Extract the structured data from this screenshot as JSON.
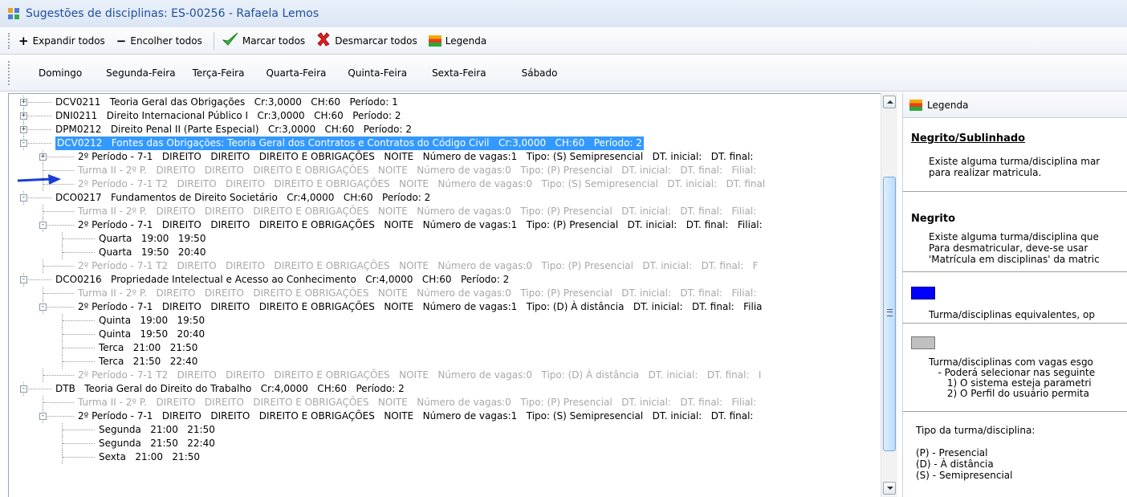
{
  "window": {
    "title": "Sugestões de disciplinas: ES-00256 - Rafaela Lemos"
  },
  "toolbar": {
    "expand_all": "Expandir todos",
    "collapse_all": "Encolher todos",
    "check_all": "Marcar todos",
    "uncheck_all": "Desmarcar todos",
    "legend": "Legenda"
  },
  "days": [
    "Domingo",
    "Segunda-Feira",
    "Terça-Feira",
    "Quarta-Feira",
    "Quinta-Feira",
    "Sexta-Feira",
    "Sábado"
  ],
  "tree": [
    {
      "level": 0,
      "expander": "+",
      "style": "normal",
      "text": "DCV0211   Teoria Geral das Obrigações   Cr:3,0000   CH:60   Período: 1"
    },
    {
      "level": 0,
      "expander": "+",
      "style": "normal",
      "text": "DNI0211   Direito Internacional Público I   Cr:3,0000   CH:60   Período: 2"
    },
    {
      "level": 0,
      "expander": "+",
      "style": "normal",
      "text": "DPM0212   Direito Penal II (Parte Especial)   Cr:3,0000   CH:60   Período: 2"
    },
    {
      "level": 0,
      "expander": "-",
      "style": "selected",
      "text": "DCV0212   Fontes das Obrigações: Teoria Geral dos Contratos e Contratos do Código Civil   Cr:3,0000   CH:60   Período: 2"
    },
    {
      "level": 1,
      "expander": "+",
      "style": "normal",
      "text": "2º Período - 7-1   DIREITO   DIREITO   DIREITO E OBRIGAÇÕES   NOITE   Número de vagas:1   Tipo: (S) Semipresencial   DT. inicial:   DT. final:"
    },
    {
      "level": 1,
      "expander": "",
      "style": "gray",
      "text": "Turma II - 2º P.   DIREITO   DIREITO   DIREITO E OBRIGAÇÕES   NOITE   Número de vagas:0   Tipo: (P) Presencial   DT. inicial:   DT. final:   Filial:"
    },
    {
      "level": 1,
      "expander": "",
      "style": "gray",
      "text": "2º Período - 7-1 T2   DIREITO   DIREITO   DIREITO E OBRIGAÇÕES   NOITE   Número de vagas:0   Tipo: (S) Semipresencial   DT. inicial:   DT. final"
    },
    {
      "level": 0,
      "expander": "-",
      "style": "normal",
      "text": "DCO0217   Fundamentos de Direito Societário   Cr:4,0000   CH:60   Período: 2"
    },
    {
      "level": 1,
      "expander": "",
      "style": "gray",
      "text": "Turma II - 2º P.   DIREITO   DIREITO   DIREITO E OBRIGAÇÕES   NOITE   Número de vagas:0   Tipo: (P) Presencial   DT. inicial:   DT. final:   Filial:"
    },
    {
      "level": 1,
      "expander": "-",
      "style": "normal",
      "text": "2º Período - 7-1   DIREITO   DIREITO   DIREITO E OBRIGAÇÕES   NOITE   Número de vagas:1   Tipo: (P) Presencial   DT. inicial:   DT. final:   Filial:"
    },
    {
      "level": 2,
      "expander": "",
      "style": "normal",
      "text": "Quarta   19:00   19:50"
    },
    {
      "level": 2,
      "expander": "",
      "style": "normal",
      "text": "Quarta   19:50   20:40"
    },
    {
      "level": 1,
      "expander": "",
      "style": "gray",
      "text": "2º Período - 7-1 T2   DIREITO   DIREITO   DIREITO E OBRIGAÇÕES   NOITE   Número de vagas:0   Tipo: (P) Presencial   DT. inicial:   DT. final:   F"
    },
    {
      "level": 0,
      "expander": "-",
      "style": "normal",
      "text": "DCO0216   Propriedade Intelectual e Acesso ao Conhecimento   Cr:4,0000   CH:60   Período: 2"
    },
    {
      "level": 1,
      "expander": "",
      "style": "gray",
      "text": "Turma II - 2º P.   DIREITO   DIREITO   DIREITO E OBRIGAÇÕES   NOITE   Número de vagas:0   Tipo: (P) Presencial   DT. inicial:   DT. final:   Filial:"
    },
    {
      "level": 1,
      "expander": "-",
      "style": "normal",
      "text": "2º Período - 7-1   DIREITO   DIREITO   DIREITO E OBRIGAÇÕES   NOITE   Número de vagas:1   Tipo: (D) À distância   DT. inicial:   DT. final:   Filia"
    },
    {
      "level": 2,
      "expander": "",
      "style": "normal",
      "text": "Quinta   19:00   19:50"
    },
    {
      "level": 2,
      "expander": "",
      "style": "normal",
      "text": "Quinta   19:50   20:40"
    },
    {
      "level": 2,
      "expander": "",
      "style": "normal",
      "text": "Terca   21:00   21:50"
    },
    {
      "level": 2,
      "expander": "",
      "style": "normal",
      "text": "Terca   21:50   22:40"
    },
    {
      "level": 1,
      "expander": "",
      "style": "gray",
      "text": "2º Período - 7-1 T2   DIREITO   DIREITO   DIREITO E OBRIGAÇÕES   NOITE   Número de vagas:0   Tipo: (D) À distância   DT. inicial:   DT. final:   I"
    },
    {
      "level": 0,
      "expander": "-",
      "style": "normal",
      "text": "DTB   Teoria Geral do Direito do Trabalho   Cr:4,0000   CH:60   Período: 2"
    },
    {
      "level": 1,
      "expander": "",
      "style": "gray",
      "text": "Turma II - 2º P.   DIREITO   DIREITO   DIREITO E OBRIGAÇÕES   NOITE   Número de vagas:0   Tipo: (P) Presencial   DT. inicial:   DT. final:   Filial:"
    },
    {
      "level": 1,
      "expander": "-",
      "style": "normal",
      "text": "2º Período - 7-1   DIREITO   DIREITO   DIREITO E OBRIGAÇÕES   NOITE   Número de vagas:1   Tipo: (S) Semipresencial   DT. inicial:   DT. final:"
    },
    {
      "level": 2,
      "expander": "",
      "style": "normal",
      "text": "Segunda   21:00   21:50"
    },
    {
      "level": 2,
      "expander": "",
      "style": "normal",
      "text": "Segunda   21:50   22:40"
    },
    {
      "level": 2,
      "expander": "",
      "style": "normal",
      "text": "Sexta   21:00   21:50"
    }
  ],
  "legend": {
    "header": "Legenda",
    "sections": [
      {
        "title": "Negrito/Sublinhado",
        "underline": true,
        "swatch": "",
        "body": "Existe alguma turma/disciplina mar\npara realizar matricula."
      },
      {
        "title": "Negrito",
        "underline": false,
        "swatch": "",
        "body": "Existe alguma turma/disciplina que\nPara desmatricular, deve-se usar\n'Matrícula em disciplinas' da matric"
      },
      {
        "title": "",
        "underline": false,
        "swatch": "#0000ff",
        "body": "Turma/disciplinas equivalentes, op"
      },
      {
        "title": "",
        "underline": false,
        "swatch": "#c0c0c0",
        "body": "Turma/disciplinas com vagas esgo\n   - Poderá selecionar nas seguinte\n      1) O sistema esteja parametri\n      2) O Perfil do usuário permita"
      },
      {
        "title": "",
        "underline": false,
        "swatch": "",
        "body": "Tipo da turma/disciplina:\n\n(P) - Presencial\n(D) - À distância\n(S) - Semipresencial"
      }
    ]
  },
  "colors": {
    "selection": "#3399ff",
    "arrow": "#1b3fd6",
    "gray_text": "#a8a8a8",
    "title_text": "#1f4e9c"
  }
}
